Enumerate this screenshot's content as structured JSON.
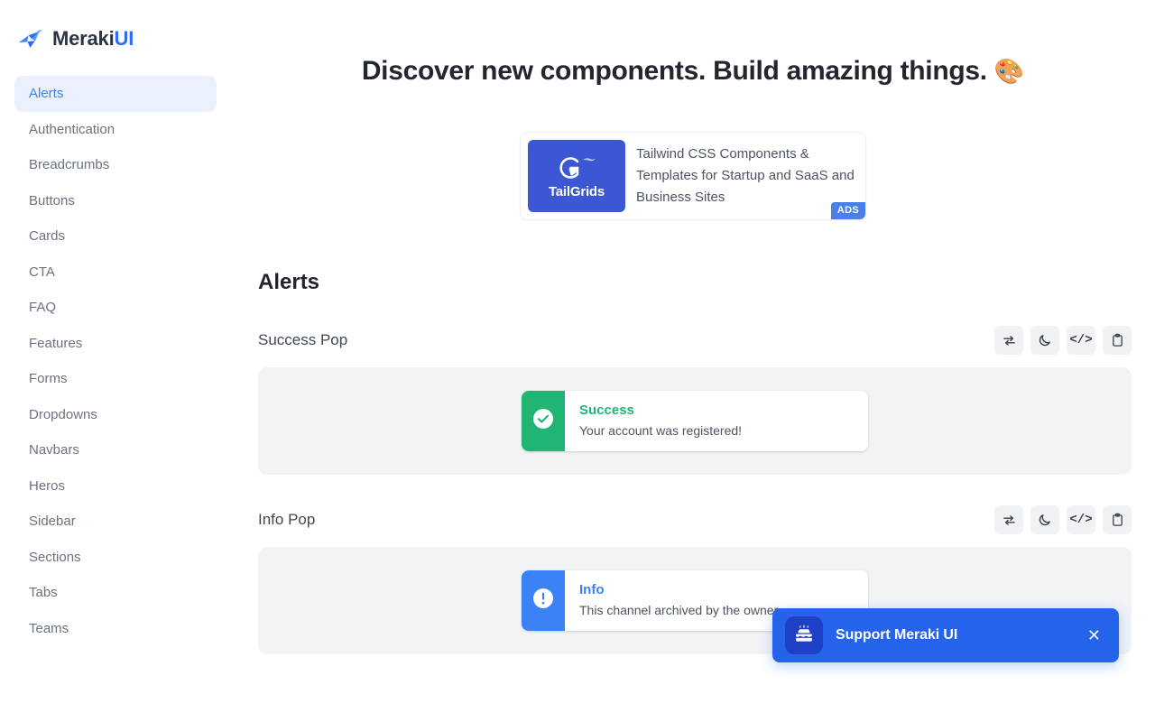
{
  "sidebar": {
    "brand": {
      "name_part1": "Meraki",
      "name_part2": "UI",
      "logo_icon": "bird-logo-icon"
    },
    "items": [
      {
        "label": "Alerts",
        "active": true
      },
      {
        "label": "Authentication",
        "active": false
      },
      {
        "label": "Breadcrumbs",
        "active": false
      },
      {
        "label": "Buttons",
        "active": false
      },
      {
        "label": "Cards",
        "active": false
      },
      {
        "label": "CTA",
        "active": false
      },
      {
        "label": "FAQ",
        "active": false
      },
      {
        "label": "Features",
        "active": false
      },
      {
        "label": "Forms",
        "active": false
      },
      {
        "label": "Dropdowns",
        "active": false
      },
      {
        "label": "Navbars",
        "active": false
      },
      {
        "label": "Heros",
        "active": false
      },
      {
        "label": "Sidebar",
        "active": false
      },
      {
        "label": "Sections",
        "active": false
      },
      {
        "label": "Tabs",
        "active": false
      },
      {
        "label": "Teams",
        "active": false
      }
    ]
  },
  "header": {
    "title": "Discover new components. Build amazing things.",
    "emoji": "🎨"
  },
  "ad": {
    "logo_text": "TailGrids",
    "logo_icon": "tailgrids-g-logo-icon",
    "text": "Tailwind CSS Components & Templates for Startup and SaaS and Business Sites",
    "badge": "ADS"
  },
  "section": {
    "title": "Alerts"
  },
  "toolbar": {
    "rtl_icon": "swap-arrows-icon",
    "dark_mode_icon": "moon-icon",
    "code_icon": "code-brackets-icon",
    "copy_icon": "clipboard-icon",
    "code_glyph": "</>"
  },
  "blocks": [
    {
      "label": "Success Pop",
      "alert": {
        "variant": "success",
        "icon": "check-circle-icon",
        "title": "Success",
        "message": "Your account was registered!",
        "accent": "#21b573"
      }
    },
    {
      "label": "Info Pop",
      "alert": {
        "variant": "info",
        "icon": "exclamation-circle-icon",
        "title": "Info",
        "message": "This channel archived by the owner",
        "accent": "#3b82f6"
      }
    }
  ],
  "support_banner": {
    "text": "Support Meraki UI",
    "icon": "birthday-cake-icon",
    "close_icon": "close-icon",
    "close_label": "✕",
    "background": "#2563eb"
  }
}
